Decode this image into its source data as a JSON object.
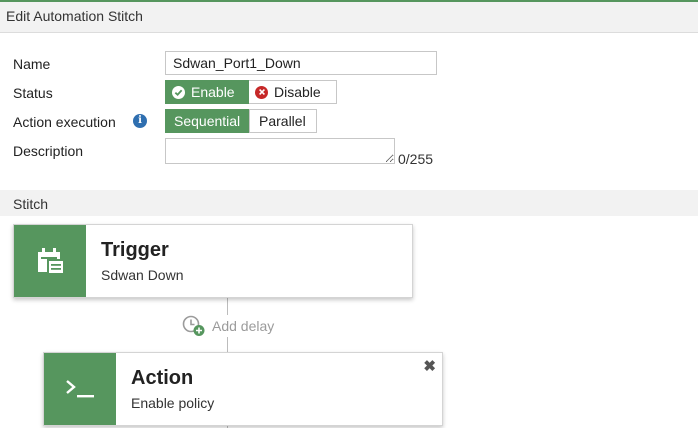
{
  "header": {
    "title": "Edit Automation Stitch"
  },
  "form": {
    "name_label": "Name",
    "name_value": "Sdwan_Port1_Down",
    "status_label": "Status",
    "status_enable": "Enable",
    "status_disable": "Disable",
    "status_selected": "Enable",
    "action_exec_label": "Action execution",
    "exec_sequential": "Sequential",
    "exec_parallel": "Parallel",
    "exec_selected": "Sequential",
    "description_label": "Description",
    "description_value": "",
    "description_counter": "0/255"
  },
  "stitch": {
    "section_label": "Stitch",
    "trigger": {
      "title": "Trigger",
      "subtitle": "Sdwan Down",
      "icon": "calendar-icon"
    },
    "add_delay": "Add delay",
    "action": {
      "title": "Action",
      "subtitle": "Enable policy",
      "icon": "terminal-icon"
    }
  },
  "colors": {
    "accent": "#56965e",
    "info": "#2f6fb0",
    "danger": "#c62828"
  }
}
